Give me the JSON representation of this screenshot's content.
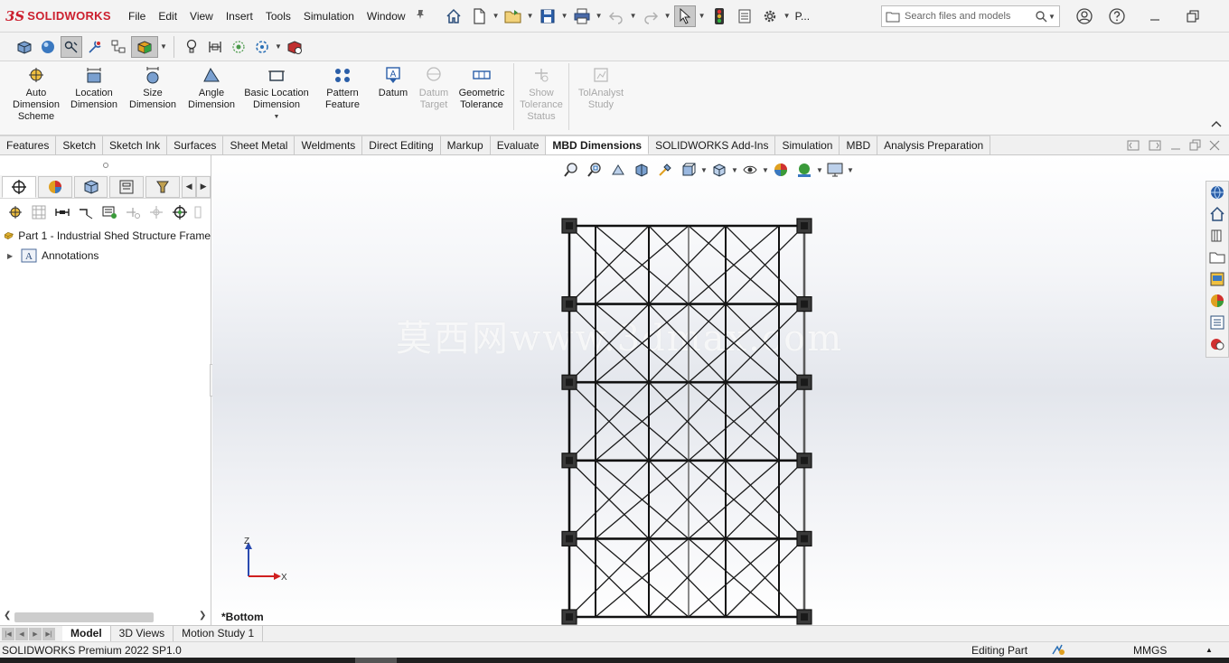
{
  "app": {
    "brand_mark": "3S",
    "brand_name": "SOLIDWORKS",
    "menu": [
      "File",
      "Edit",
      "View",
      "Insert",
      "Tools",
      "Simulation",
      "Window"
    ],
    "profile_label": "P...",
    "search_placeholder": "Search files and models"
  },
  "ribbon": {
    "buttons": [
      {
        "label": "Auto Dimension Scheme",
        "enabled": true
      },
      {
        "label": "Location Dimension",
        "enabled": true
      },
      {
        "label": "Size Dimension",
        "enabled": true
      },
      {
        "label": "Angle Dimension",
        "enabled": true
      },
      {
        "label": "Basic Location Dimension",
        "enabled": true
      },
      {
        "label": "Pattern Feature",
        "enabled": true
      },
      {
        "label": "Datum",
        "enabled": true
      },
      {
        "label": "Datum Target",
        "enabled": false
      },
      {
        "label": "Geometric Tolerance",
        "enabled": true
      },
      {
        "label": "Show Tolerance Status",
        "enabled": false
      },
      {
        "label": "TolAnalyst Study",
        "enabled": false
      }
    ]
  },
  "command_tabs": [
    {
      "label": "Features",
      "active": false
    },
    {
      "label": "Sketch",
      "active": false
    },
    {
      "label": "Sketch Ink",
      "active": false
    },
    {
      "label": "Surfaces",
      "active": false
    },
    {
      "label": "Sheet Metal",
      "active": false
    },
    {
      "label": "Weldments",
      "active": false
    },
    {
      "label": "Direct Editing",
      "active": false
    },
    {
      "label": "Markup",
      "active": false
    },
    {
      "label": "Evaluate",
      "active": false
    },
    {
      "label": "MBD Dimensions",
      "active": true
    },
    {
      "label": "SOLIDWORKS Add-Ins",
      "active": false
    },
    {
      "label": "Simulation",
      "active": false
    },
    {
      "label": "MBD",
      "active": false
    },
    {
      "label": "Analysis Preparation",
      "active": false
    }
  ],
  "tree": {
    "root": "Part 1 - Industrial Shed Structure Frame",
    "items": [
      "Annotations"
    ]
  },
  "viewport": {
    "view_name": "*Bottom",
    "watermark": "莫西网www.3dmax.com",
    "axis_z": "Z",
    "axis_x": "X"
  },
  "frame_model": {
    "rows": 6,
    "columns": 2,
    "bays": 5
  },
  "bottom_tabs": [
    {
      "label": "Model",
      "active": true
    },
    {
      "label": "3D Views",
      "active": false
    },
    {
      "label": "Motion Study 1",
      "active": false
    }
  ],
  "status": {
    "product": "SOLIDWORKS Premium 2022 SP1.0",
    "mode": "Editing Part",
    "units": "MMGS"
  },
  "colors": {
    "brand_red": "#cc1f2e",
    "accent_blue": "#2a6fb5"
  }
}
